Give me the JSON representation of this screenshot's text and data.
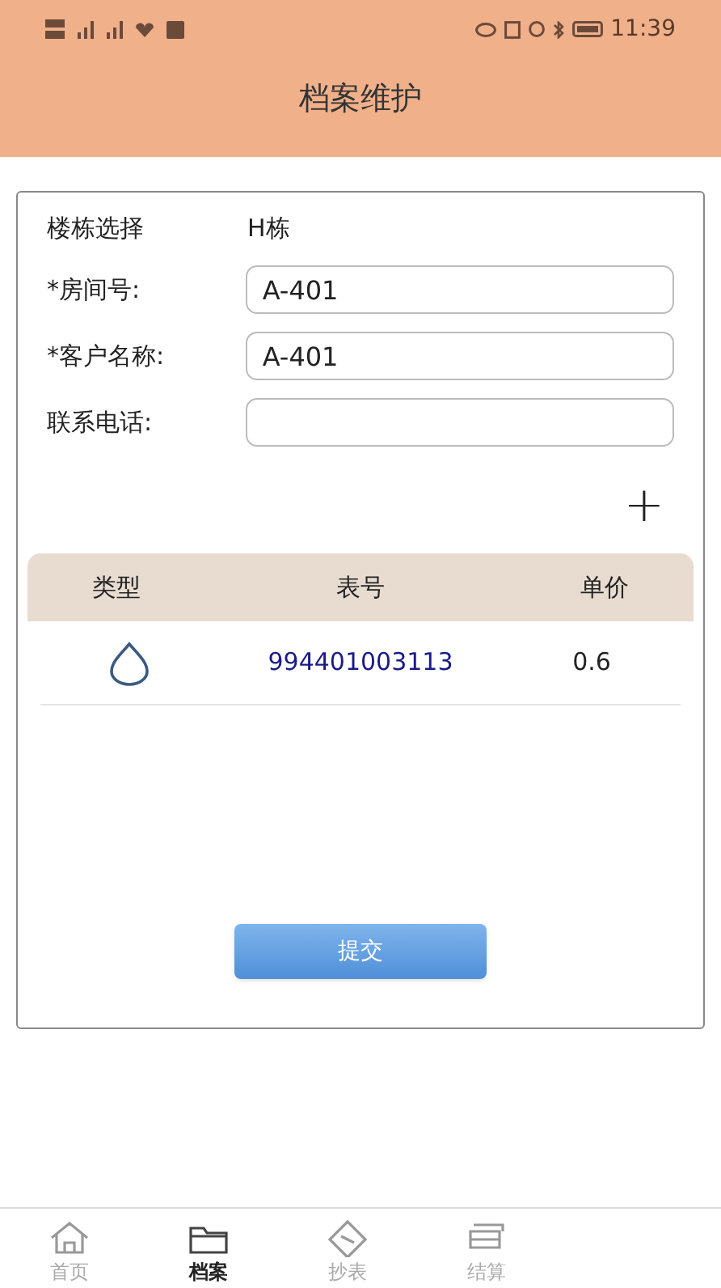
{
  "status_bar": {
    "time": "11:39"
  },
  "header": {
    "title": "档案维护"
  },
  "form": {
    "building": {
      "label": "楼栋选择",
      "value": "H栋"
    },
    "fields": [
      {
        "label": "*房间号:",
        "value": "A-401"
      },
      {
        "label": "*客户名称:",
        "value": "A-401"
      },
      {
        "label": "联系电话:"
      }
    ]
  },
  "add_button": {
    "label": "+"
  },
  "table": {
    "columns": [
      "类型",
      "表号",
      "单价"
    ],
    "rows": [
      {
        "meter_number": "994401003113",
        "price": "0.6"
      }
    ]
  },
  "submit_button": {
    "label": "提交"
  },
  "tab_bar": {
    "items": [
      {
        "label": "首页",
        "selected": false
      },
      {
        "label": "档案",
        "selected": true
      },
      {
        "label": "抄表",
        "selected": false
      },
      {
        "label": "结算",
        "selected": false
      }
    ]
  }
}
